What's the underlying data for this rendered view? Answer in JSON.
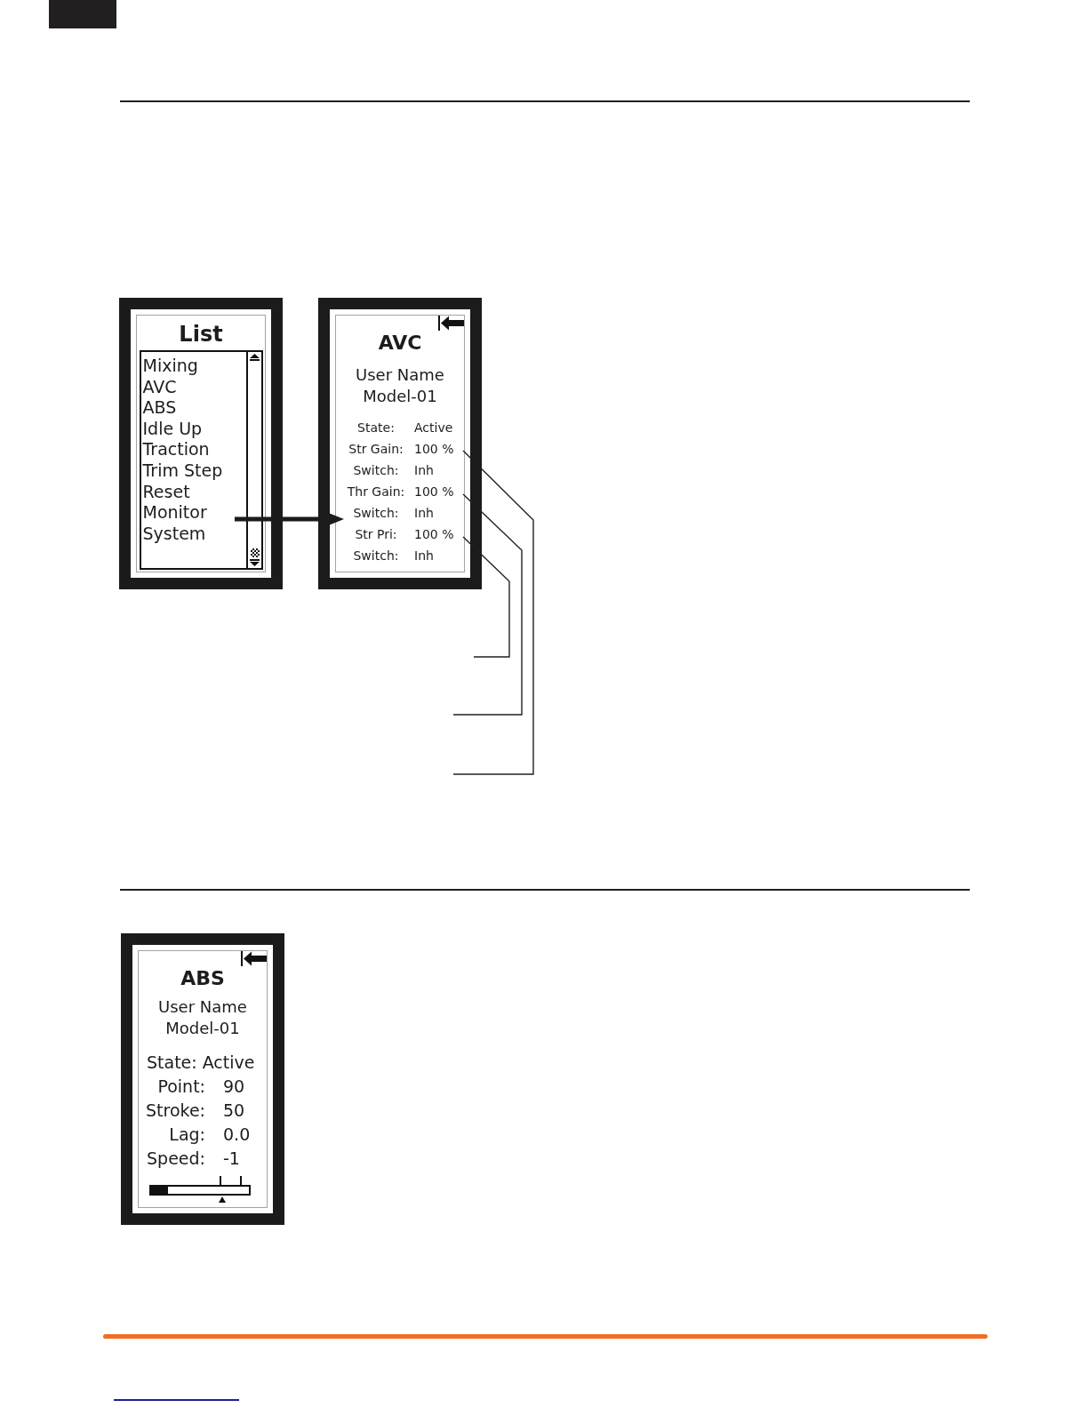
{
  "list_screen": {
    "title": "List",
    "items": [
      "Mixing",
      "AVC",
      "ABS",
      "Idle Up",
      "Traction",
      "Trim Step",
      "Reset",
      "Monitor",
      "System"
    ]
  },
  "avc_screen": {
    "title": "AVC",
    "user_name": "User Name",
    "model_name": "Model-01",
    "rows": [
      {
        "kind": "param",
        "label": "State:",
        "value": "Active"
      },
      {
        "kind": "param",
        "label": "Str Gain:",
        "value": "100 %"
      },
      {
        "kind": "param",
        "label": "Switch:",
        "value": "Inh"
      },
      {
        "kind": "param",
        "label": "Thr Gain:",
        "value": "100 %"
      },
      {
        "kind": "param",
        "label": "Switch:",
        "value": "Inh"
      },
      {
        "kind": "param",
        "label": "Str Pri:",
        "value": "100 %"
      },
      {
        "kind": "param",
        "label": "Switch:",
        "value": "Inh"
      }
    ]
  },
  "abs_screen": {
    "title": "ABS",
    "user_name": "User Name",
    "model_name": "Model-01",
    "rows": [
      {
        "kind": "inline",
        "label": "State:",
        "value": "Active"
      },
      {
        "kind": "param",
        "label": "Point:",
        "value": "90"
      },
      {
        "kind": "param",
        "label": "Stroke:",
        "value": "50"
      },
      {
        "kind": "param",
        "label": "Lag:",
        "value": "0.0"
      },
      {
        "kind": "param",
        "label": "Speed:",
        "value": "-1"
      }
    ],
    "gauge": {
      "level": 0.17
    }
  }
}
